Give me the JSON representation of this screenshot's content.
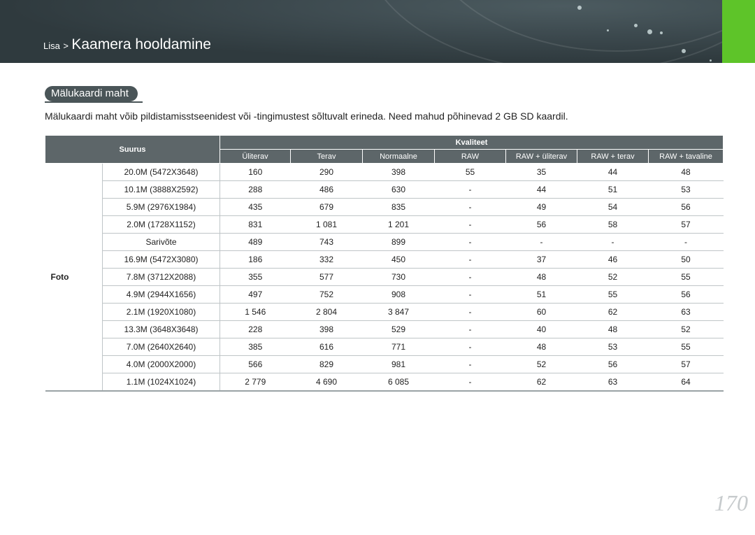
{
  "header": {
    "crumb_parent": "Lisa",
    "crumb_sep": ">",
    "crumb_current": "Kaamera hooldamine"
  },
  "section": {
    "title": "Mälukaardi maht",
    "intro": "Mälukaardi maht võib pildistamisstseenidest või -tingimustest sõltuvalt erineda. Need mahud põhinevad 2 GB SD kaardil."
  },
  "table": {
    "size_header": "Suurus",
    "quality_header": "Kvaliteet",
    "quality_columns": [
      "Üliterav",
      "Terav",
      "Normaalne",
      "RAW",
      "RAW + üliterav",
      "RAW + terav",
      "RAW + tavaline"
    ],
    "row_group_label": "Foto",
    "rows": [
      {
        "size": "20.0M (5472X3648)",
        "values": [
          "160",
          "290",
          "398",
          "55",
          "35",
          "44",
          "48"
        ]
      },
      {
        "size": "10.1M (3888X2592)",
        "values": [
          "288",
          "486",
          "630",
          "-",
          "44",
          "51",
          "53"
        ]
      },
      {
        "size": "5.9M (2976X1984)",
        "values": [
          "435",
          "679",
          "835",
          "-",
          "49",
          "54",
          "56"
        ]
      },
      {
        "size": "2.0M (1728X1152)",
        "values": [
          "831",
          "1 081",
          "1 201",
          "-",
          "56",
          "58",
          "57"
        ]
      },
      {
        "size": "Sarivõte",
        "values": [
          "489",
          "743",
          "899",
          "-",
          "-",
          "-",
          "-"
        ]
      },
      {
        "size": "16.9M (5472X3080)",
        "values": [
          "186",
          "332",
          "450",
          "-",
          "37",
          "46",
          "50"
        ]
      },
      {
        "size": "7.8M (3712X2088)",
        "values": [
          "355",
          "577",
          "730",
          "-",
          "48",
          "52",
          "55"
        ]
      },
      {
        "size": "4.9M (2944X1656)",
        "values": [
          "497",
          "752",
          "908",
          "-",
          "51",
          "55",
          "56"
        ]
      },
      {
        "size": "2.1M (1920X1080)",
        "values": [
          "1 546",
          "2 804",
          "3 847",
          "-",
          "60",
          "62",
          "63"
        ]
      },
      {
        "size": "13.3M (3648X3648)",
        "values": [
          "228",
          "398",
          "529",
          "-",
          "40",
          "48",
          "52"
        ]
      },
      {
        "size": "7.0M (2640X2640)",
        "values": [
          "385",
          "616",
          "771",
          "-",
          "48",
          "53",
          "55"
        ]
      },
      {
        "size": "4.0M (2000X2000)",
        "values": [
          "566",
          "829",
          "981",
          "-",
          "52",
          "56",
          "57"
        ]
      },
      {
        "size": "1.1M (1024X1024)",
        "values": [
          "2 779",
          "4 690",
          "6 085",
          "-",
          "62",
          "63",
          "64"
        ]
      }
    ]
  },
  "page_number": "170",
  "colors": {
    "header_bg": "#3d4a4f",
    "accent_green": "#5ec429",
    "table_header_bg": "#5d6669"
  }
}
